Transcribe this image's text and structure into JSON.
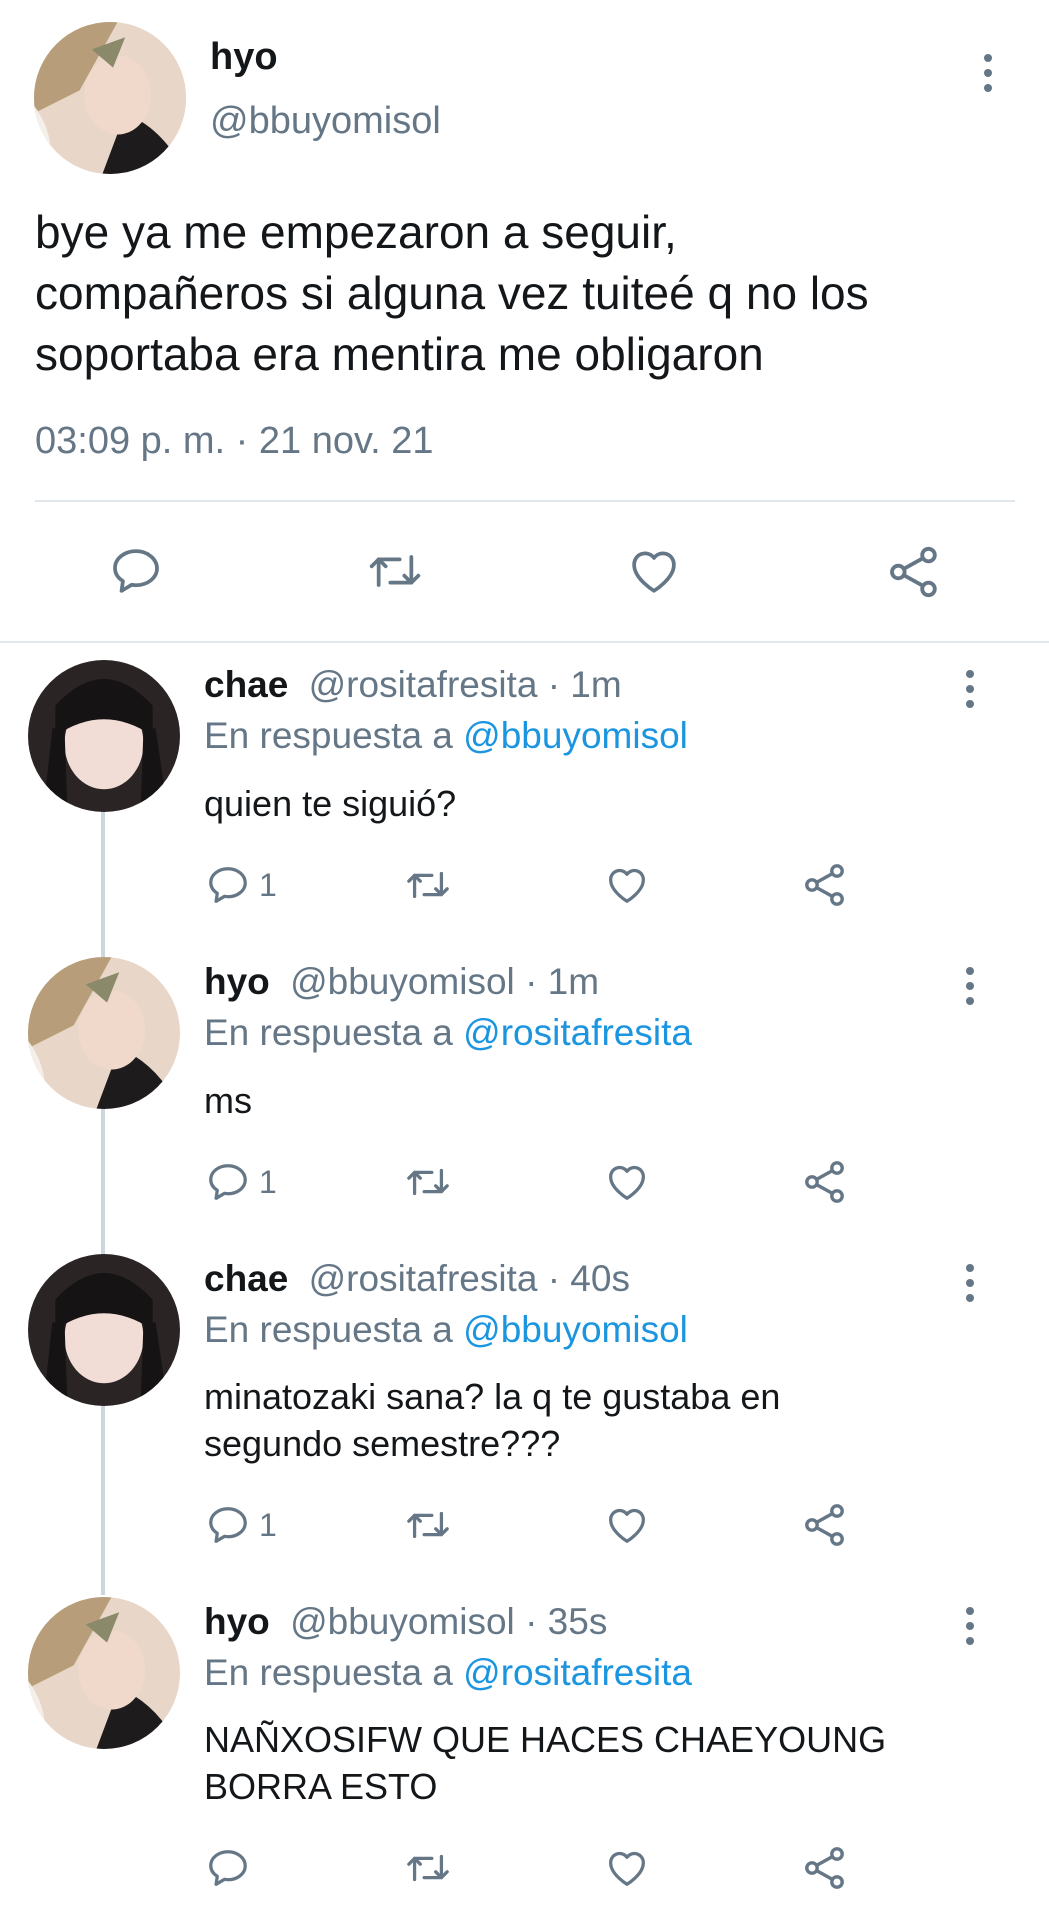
{
  "main_tweet": {
    "name": "hyo",
    "handle": "@bbuyomisol",
    "text_lines": [
      "bye ya me empezaron a seguir,",
      "compañeros si alguna vez tuiteé q no los",
      "soportaba era mentira me obligaron"
    ],
    "timestamp": "03:09 p. m. · 21 nov. 21"
  },
  "replies": [
    {
      "name": "chae",
      "handle": "@rositafresita",
      "time": "· 1m",
      "reply_prefix": "En respuesta a",
      "reply_to": "@bbuyomisol",
      "text_lines": [
        "quien te siguió?"
      ],
      "reply_count": "1"
    },
    {
      "name": "hyo",
      "handle": "@bbuyomisol",
      "time": "· 1m",
      "reply_prefix": "En respuesta a",
      "reply_to": "@rositafresita",
      "text_lines": [
        "ms"
      ],
      "reply_count": "1"
    },
    {
      "name": "chae",
      "handle": "@rositafresita",
      "time": "· 40s",
      "reply_prefix": "En respuesta a",
      "reply_to": "@bbuyomisol",
      "text_lines": [
        "minatozaki sana? la q te gustaba en",
        "segundo semestre???"
      ],
      "reply_count": "1"
    },
    {
      "name": "hyo",
      "handle": "@bbuyomisol",
      "time": "· 35s",
      "reply_prefix": "En respuesta a",
      "reply_to": "@rositafresita",
      "text_lines": [
        "NAÑXOSIFW QUE HACES CHAEYOUNG",
        "BORRA ESTO"
      ],
      "reply_count": ""
    }
  ],
  "icons": {
    "reply": "reply-icon",
    "retweet": "retweet-icon",
    "like": "heart-icon",
    "share": "share-icon",
    "more": "more-vertical-icon"
  },
  "colors": {
    "text": "#14171a",
    "muted": "#657786",
    "link": "#1b95e0",
    "divider": "#e1e8ed",
    "thread_line": "#ccd6dd"
  }
}
